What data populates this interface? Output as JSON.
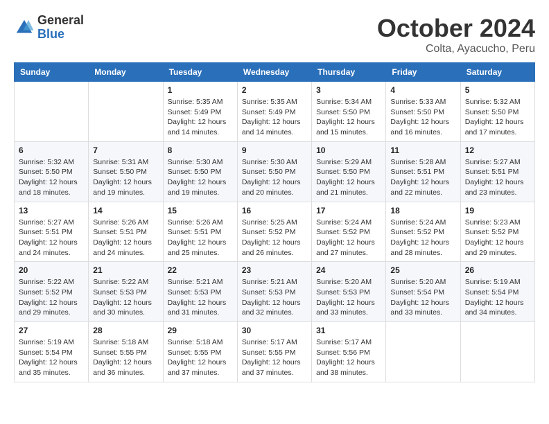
{
  "header": {
    "logo_general": "General",
    "logo_blue": "Blue",
    "month": "October 2024",
    "location": "Colta, Ayacucho, Peru"
  },
  "days_of_week": [
    "Sunday",
    "Monday",
    "Tuesday",
    "Wednesday",
    "Thursday",
    "Friday",
    "Saturday"
  ],
  "weeks": [
    [
      {
        "day": "",
        "info": ""
      },
      {
        "day": "",
        "info": ""
      },
      {
        "day": "1",
        "sunrise": "5:35 AM",
        "sunset": "5:49 PM",
        "daylight": "12 hours and 14 minutes."
      },
      {
        "day": "2",
        "sunrise": "5:35 AM",
        "sunset": "5:49 PM",
        "daylight": "12 hours and 14 minutes."
      },
      {
        "day": "3",
        "sunrise": "5:34 AM",
        "sunset": "5:50 PM",
        "daylight": "12 hours and 15 minutes."
      },
      {
        "day": "4",
        "sunrise": "5:33 AM",
        "sunset": "5:50 PM",
        "daylight": "12 hours and 16 minutes."
      },
      {
        "day": "5",
        "sunrise": "5:32 AM",
        "sunset": "5:50 PM",
        "daylight": "12 hours and 17 minutes."
      }
    ],
    [
      {
        "day": "6",
        "sunrise": "5:32 AM",
        "sunset": "5:50 PM",
        "daylight": "12 hours and 18 minutes."
      },
      {
        "day": "7",
        "sunrise": "5:31 AM",
        "sunset": "5:50 PM",
        "daylight": "12 hours and 19 minutes."
      },
      {
        "day": "8",
        "sunrise": "5:30 AM",
        "sunset": "5:50 PM",
        "daylight": "12 hours and 19 minutes."
      },
      {
        "day": "9",
        "sunrise": "5:30 AM",
        "sunset": "5:50 PM",
        "daylight": "12 hours and 20 minutes."
      },
      {
        "day": "10",
        "sunrise": "5:29 AM",
        "sunset": "5:50 PM",
        "daylight": "12 hours and 21 minutes."
      },
      {
        "day": "11",
        "sunrise": "5:28 AM",
        "sunset": "5:51 PM",
        "daylight": "12 hours and 22 minutes."
      },
      {
        "day": "12",
        "sunrise": "5:27 AM",
        "sunset": "5:51 PM",
        "daylight": "12 hours and 23 minutes."
      }
    ],
    [
      {
        "day": "13",
        "sunrise": "5:27 AM",
        "sunset": "5:51 PM",
        "daylight": "12 hours and 24 minutes."
      },
      {
        "day": "14",
        "sunrise": "5:26 AM",
        "sunset": "5:51 PM",
        "daylight": "12 hours and 24 minutes."
      },
      {
        "day": "15",
        "sunrise": "5:26 AM",
        "sunset": "5:51 PM",
        "daylight": "12 hours and 25 minutes."
      },
      {
        "day": "16",
        "sunrise": "5:25 AM",
        "sunset": "5:52 PM",
        "daylight": "12 hours and 26 minutes."
      },
      {
        "day": "17",
        "sunrise": "5:24 AM",
        "sunset": "5:52 PM",
        "daylight": "12 hours and 27 minutes."
      },
      {
        "day": "18",
        "sunrise": "5:24 AM",
        "sunset": "5:52 PM",
        "daylight": "12 hours and 28 minutes."
      },
      {
        "day": "19",
        "sunrise": "5:23 AM",
        "sunset": "5:52 PM",
        "daylight": "12 hours and 29 minutes."
      }
    ],
    [
      {
        "day": "20",
        "sunrise": "5:22 AM",
        "sunset": "5:52 PM",
        "daylight": "12 hours and 29 minutes."
      },
      {
        "day": "21",
        "sunrise": "5:22 AM",
        "sunset": "5:53 PM",
        "daylight": "12 hours and 30 minutes."
      },
      {
        "day": "22",
        "sunrise": "5:21 AM",
        "sunset": "5:53 PM",
        "daylight": "12 hours and 31 minutes."
      },
      {
        "day": "23",
        "sunrise": "5:21 AM",
        "sunset": "5:53 PM",
        "daylight": "12 hours and 32 minutes."
      },
      {
        "day": "24",
        "sunrise": "5:20 AM",
        "sunset": "5:53 PM",
        "daylight": "12 hours and 33 minutes."
      },
      {
        "day": "25",
        "sunrise": "5:20 AM",
        "sunset": "5:54 PM",
        "daylight": "12 hours and 33 minutes."
      },
      {
        "day": "26",
        "sunrise": "5:19 AM",
        "sunset": "5:54 PM",
        "daylight": "12 hours and 34 minutes."
      }
    ],
    [
      {
        "day": "27",
        "sunrise": "5:19 AM",
        "sunset": "5:54 PM",
        "daylight": "12 hours and 35 minutes."
      },
      {
        "day": "28",
        "sunrise": "5:18 AM",
        "sunset": "5:55 PM",
        "daylight": "12 hours and 36 minutes."
      },
      {
        "day": "29",
        "sunrise": "5:18 AM",
        "sunset": "5:55 PM",
        "daylight": "12 hours and 37 minutes."
      },
      {
        "day": "30",
        "sunrise": "5:17 AM",
        "sunset": "5:55 PM",
        "daylight": "12 hours and 37 minutes."
      },
      {
        "day": "31",
        "sunrise": "5:17 AM",
        "sunset": "5:56 PM",
        "daylight": "12 hours and 38 minutes."
      },
      {
        "day": "",
        "info": ""
      },
      {
        "day": "",
        "info": ""
      }
    ]
  ]
}
